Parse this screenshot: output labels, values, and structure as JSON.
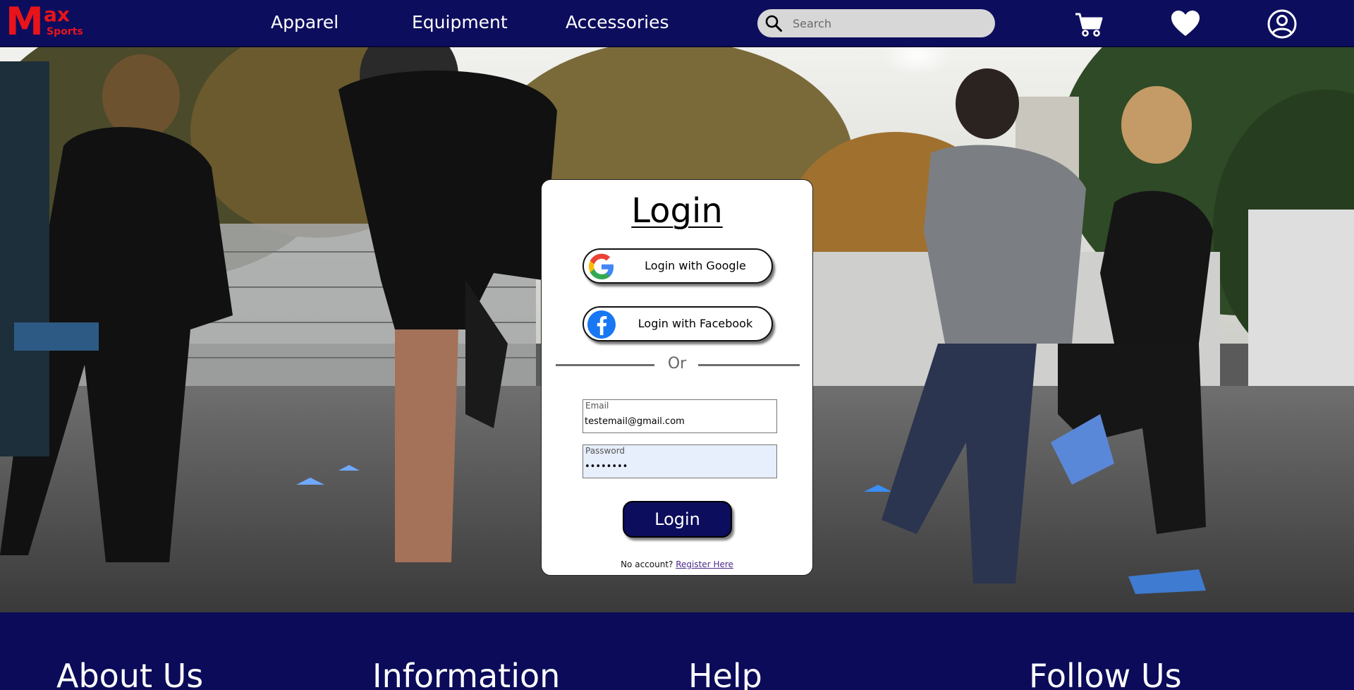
{
  "brand": {
    "logo_m": "M",
    "logo_ax": "ax",
    "logo_sub": "Sports",
    "color": "#e8141a"
  },
  "nav": {
    "links": [
      "Apparel",
      "Equipment",
      "Accessories"
    ],
    "search_placeholder": "Search",
    "icons": [
      "cart-icon",
      "heart-icon",
      "user-account-icon"
    ]
  },
  "login": {
    "title": "Login",
    "google_label": "Login with Google",
    "facebook_label": "Login with Facebook",
    "or_text": "Or",
    "email_label": "Email",
    "email_value": "testemail@gmail.com",
    "password_label": "Password",
    "password_value": "********",
    "submit_label": "Login",
    "no_account_text": "No account?",
    "register_link": "Register Here"
  },
  "footer": {
    "headings": [
      "About Us",
      "Information",
      "Help",
      "Follow Us"
    ]
  },
  "colors": {
    "navy": "#0d0d5e",
    "search_bg": "#d7d7d7",
    "autofill_bg": "#e7eefc"
  }
}
